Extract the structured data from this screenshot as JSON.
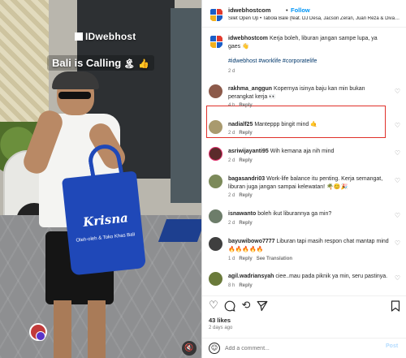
{
  "media": {
    "watermark": "IDwebhost",
    "caption": "Bali is Calling",
    "caption_emoji": "🏝 👍",
    "bag_brand": "Krisna",
    "bag_tagline": "Oleh-oleh & Toko Khas Bali"
  },
  "header": {
    "username": "idwebhostcom",
    "follow_label": "Follow",
    "song": "Silet Open Up • Tabola Bale (feat. DJ Desa, Jacson Zeran, Juan Reza & Diva Bulan)"
  },
  "caption_post": {
    "username": "idwebhostcom",
    "text": "Kerja boleh, liburan jangan sampe lupa, ya gaes 👋",
    "hashtags": "#idwebhost #worklife #corporatelife",
    "time": "2 d"
  },
  "comments": [
    {
      "username": "rakhma_anggun",
      "text": "Kopernya isinya baju kan min bukan perangkat kerja 👀",
      "time": "4 h",
      "reply": "Reply",
      "avatar_color": "#8c5a4a"
    },
    {
      "username": "nadialf25",
      "text": "Manteppp bingit mind 🤙",
      "time": "2 d",
      "reply": "Reply",
      "avatar_color": "#a99a6e"
    },
    {
      "username": "asriwijayanti95",
      "text": "Wih kemana aja nih mind",
      "time": "2 d",
      "reply": "Reply",
      "avatar_color": "#5b2b2b"
    },
    {
      "username": "bagasandri03",
      "text": "Work-life balance itu penting. Kerja semangat, liburan juga jangan sampai kelewatan! 🌴😊🎉",
      "time": "2 d",
      "reply": "Reply",
      "avatar_color": "#7c8a5a"
    },
    {
      "username": "isnawanto",
      "text": "boleh ikut liburannya ga min?",
      "time": "2 d",
      "reply": "Reply",
      "avatar_color": "#6d7d6a"
    },
    {
      "username": "bayuwibowo7777",
      "text": "Liburan tapi masih respon chat mantap mind 🔥🔥🔥🔥🔥",
      "time": "1 d",
      "reply": "Reply",
      "translate": "See Translation",
      "avatar_color": "#3f3f3f"
    },
    {
      "username": "agil.wadriansyah",
      "text": "ciee..mau pada piknik ya min, seru pastinya.",
      "time": "8 h",
      "reply": "Reply",
      "avatar_color": "#6a7a3a"
    }
  ],
  "actions": {
    "likes": "43 likes",
    "date": "2 days ago",
    "comment_placeholder": "Add a comment...",
    "post_label": "Post"
  },
  "icons": {
    "like": "heart-icon",
    "comment": "comment-icon",
    "share": "share-icon",
    "save": "bookmark-icon",
    "emoji": "emoji-icon",
    "mute": "speaker-muted-icon"
  },
  "colors": {
    "accent": "#0095f6",
    "hashtag": "#00376b",
    "highlight": "#e0302a",
    "bag": "#1f48b8"
  }
}
